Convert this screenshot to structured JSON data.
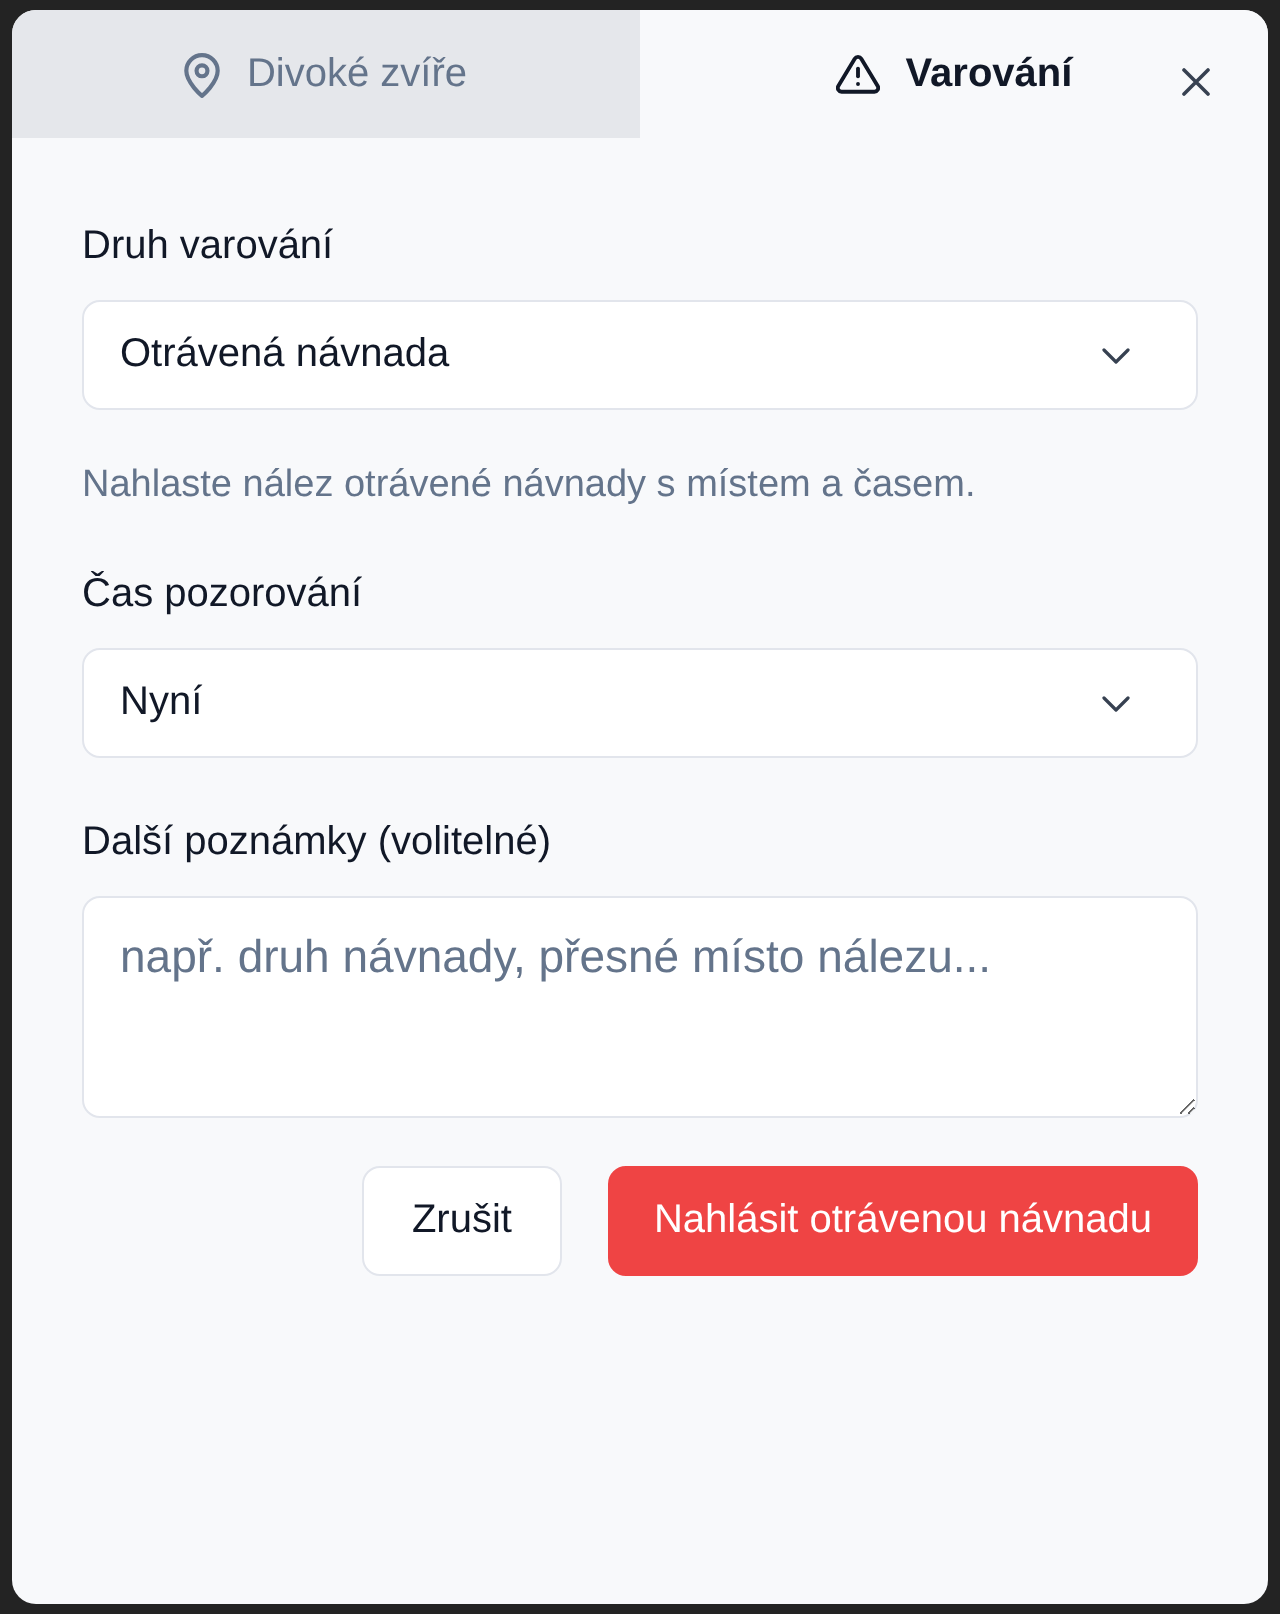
{
  "tabs": [
    {
      "label": "Divoké zvíře",
      "selected": false
    },
    {
      "label": "Varování",
      "selected": true
    }
  ],
  "fields": [
    {
      "kind": "select",
      "label": "Druh varování",
      "value": "Otrávená návnada",
      "help": "Nahlaste nález otrávené návnady s místem a časem."
    },
    {
      "kind": "select",
      "label": "Čas pozorování",
      "value": "Nyní"
    },
    {
      "kind": "textarea",
      "label": "Další poznámky (volitelné)",
      "placeholder": "např. druh návnady, přesné místo nálezu..."
    }
  ],
  "buttons": [
    {
      "label": "Zrušit",
      "kind": "secondary"
    },
    {
      "label": "Nahlásit otrávenou návnadu",
      "kind": "primary"
    }
  ]
}
